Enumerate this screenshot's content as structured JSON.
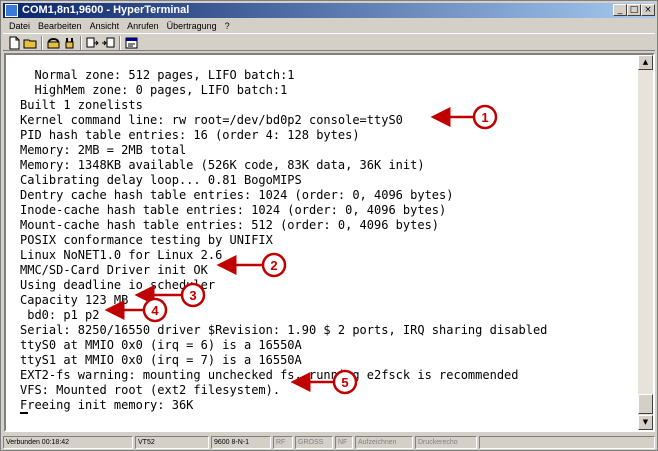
{
  "window": {
    "title": "COM1,8n1,9600 - HyperTerminal",
    "buttons": {
      "minimize": "_",
      "maximize": "□",
      "close": "×"
    }
  },
  "menu": {
    "items": [
      "Datei",
      "Bearbeiten",
      "Ansicht",
      "Anrufen",
      "Übertragung",
      "?"
    ]
  },
  "toolbar": {
    "icons": [
      "new-document-icon",
      "open-folder-icon",
      "connect-phone-icon",
      "disconnect-phone-icon",
      "send-file-icon",
      "receive-file-icon",
      "properties-icon"
    ]
  },
  "terminal": {
    "lines": [
      "  Normal zone: 512 pages, LIFO batch:1",
      "  HighMem zone: 0 pages, LIFO batch:1",
      "Built 1 zonelists",
      "Kernel command line: rw root=/dev/bd0p2 console=ttyS0",
      "PID hash table entries: 16 (order 4: 128 bytes)",
      "Memory: 2MB = 2MB total",
      "Memory: 1348KB available (526K code, 83K data, 36K init)",
      "Calibrating delay loop... 0.81 BogoMIPS",
      "Dentry cache hash table entries: 1024 (order: 0, 4096 bytes)",
      "Inode-cache hash table entries: 1024 (order: 0, 4096 bytes)",
      "Mount-cache hash table entries: 512 (order: 0, 4096 bytes)",
      "POSIX conformance testing by UNIFIX",
      "Linux NoNET1.0 for Linux 2.6",
      "MMC/SD-Card Driver init OK",
      "Using deadline io scheduler",
      "Capacity 123 MB",
      " bd0: p1 p2",
      "Serial: 8250/16550 driver $Revision: 1.90 $ 2 ports, IRQ sharing disabled",
      "ttyS0 at MMIO 0x0 (irq = 6) is a 16550A",
      "ttyS1 at MMIO 0x0 (irq = 7) is a 16550A",
      "EXT2-fs warning: mounting unchecked fs, running e2fsck is recommended",
      "VFS: Mounted root (ext2 filesystem).",
      "Freeing init memory: 36K"
    ]
  },
  "annotations": {
    "color": "#c00000",
    "labels": [
      "1",
      "2",
      "3",
      "4",
      "5"
    ]
  },
  "status": {
    "connected": "Verbunden 00:18:42",
    "emulation": "VT52",
    "port": "9600 8-N-1",
    "rf": "RF",
    "gross": "GROSS",
    "nf": "NF",
    "capture": "Aufzeichnen",
    "print": "Druckerecho"
  }
}
